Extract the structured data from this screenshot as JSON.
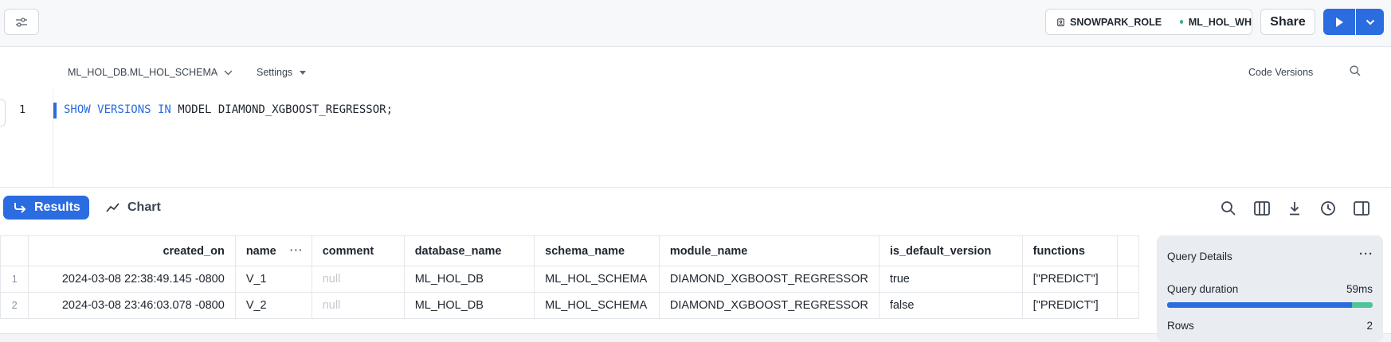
{
  "toolbar": {
    "role": "SNOWPARK_ROLE",
    "warehouse": "ML_HOL_WH",
    "share_label": "Share"
  },
  "editor": {
    "schema": "ML_HOL_DB.ML_HOL_SCHEMA",
    "settings_label": "Settings",
    "code_versions_label": "Code Versions",
    "line_number": "1",
    "code_keyword_1": "SHOW VERSIONS IN",
    "code_rest": " MODEL DIAMOND_XGBOOST_REGRESSOR;"
  },
  "results": {
    "results_tab": "Results",
    "chart_tab": "Chart",
    "columns": [
      "created_on",
      "name",
      "comment",
      "database_name",
      "schema_name",
      "module_name",
      "is_default_version",
      "functions"
    ],
    "rows": [
      {
        "idx": "1",
        "created_on": "2024-03-08 22:38:49.145 -0800",
        "name": "V_1",
        "comment": "null",
        "database_name": "ML_HOL_DB",
        "schema_name": "ML_HOL_SCHEMA",
        "module_name": "DIAMOND_XGBOOST_REGRESSOR",
        "is_default_version": "true",
        "functions": "[\"PREDICT\"]"
      },
      {
        "idx": "2",
        "created_on": "2024-03-08 23:46:03.078 -0800",
        "name": "V_2",
        "comment": "null",
        "database_name": "ML_HOL_DB",
        "schema_name": "ML_HOL_SCHEMA",
        "module_name": "DIAMOND_XGBOOST_REGRESSOR",
        "is_default_version": "false",
        "functions": "[\"PREDICT\"]"
      }
    ]
  },
  "query_details": {
    "title": "Query Details",
    "duration_label": "Query duration",
    "duration_value": "59ms",
    "duration_fraction_primary": 0.9,
    "rows_label": "Rows",
    "rows_value": "2"
  },
  "colors": {
    "accent": "#2b6ce0",
    "status_dot": "#3ab27e",
    "bar_secondary": "#4fc39a"
  }
}
